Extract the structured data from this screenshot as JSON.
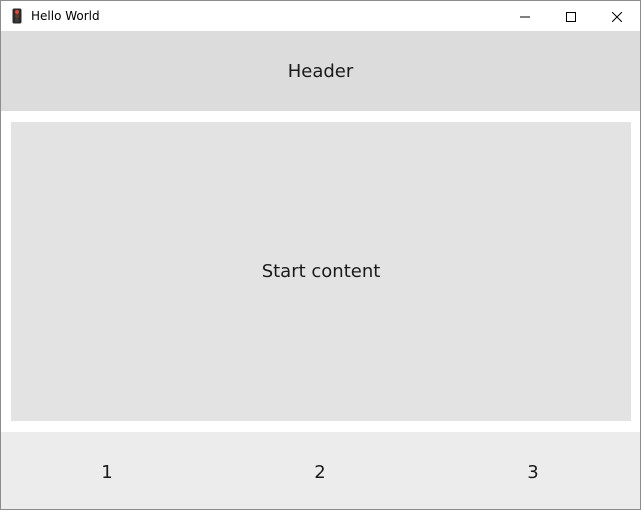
{
  "window": {
    "title": "Hello World",
    "app_icon": "traffic-light-icon"
  },
  "caption": {
    "minimize_icon": "minimize-icon",
    "maximize_icon": "maximize-icon",
    "close_icon": "close-icon"
  },
  "header": {
    "text": "Header",
    "background": "#dcdcdc"
  },
  "content": {
    "text": "Start content",
    "background": "#e3e3e3"
  },
  "footer": {
    "items": [
      "1",
      "2",
      "3"
    ],
    "background": "#ececec"
  }
}
